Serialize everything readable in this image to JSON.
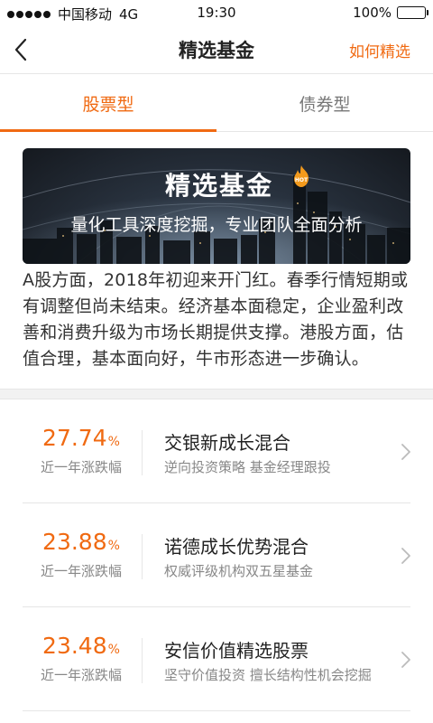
{
  "status_bar": {
    "carrier": "中国移动",
    "network": "4G",
    "time": "19:30",
    "battery": "100%",
    "battery_level": 1.0
  },
  "nav": {
    "title": "精选基金",
    "action": "如何精选"
  },
  "tabs": [
    {
      "label": "股票型",
      "active": true
    },
    {
      "label": "债券型",
      "active": false
    }
  ],
  "banner": {
    "title": "精选基金",
    "badge": "HOT",
    "subtitle": "量化工具深度挖掘，专业团队全面分析"
  },
  "description": "A股方面，2018年初迎来开门红。春季行情短期或有调整但尚未结束。经济基本面稳定，企业盈利改善和消费升级为市场长期提供支撑。港股方面，估值合理，基本面向好，牛市形态进一步确认。",
  "funds": [
    {
      "rate": "27.74",
      "unit": "%",
      "rate_label": "近一年涨跌幅",
      "name": "交银新成长混合",
      "desc": "逆向投资策略 基金经理跟投"
    },
    {
      "rate": "23.88",
      "unit": "%",
      "rate_label": "近一年涨跌幅",
      "name": "诺德成长优势混合",
      "desc": "权威评级机构双五星基金"
    },
    {
      "rate": "23.48",
      "unit": "%",
      "rate_label": "近一年涨跌幅",
      "name": "安信价值精选股票",
      "desc": "坚守价值投资 擅长结构性机会挖掘"
    }
  ],
  "colors": {
    "accent": "#f06a12",
    "text": "#222222",
    "muted": "#888888"
  }
}
